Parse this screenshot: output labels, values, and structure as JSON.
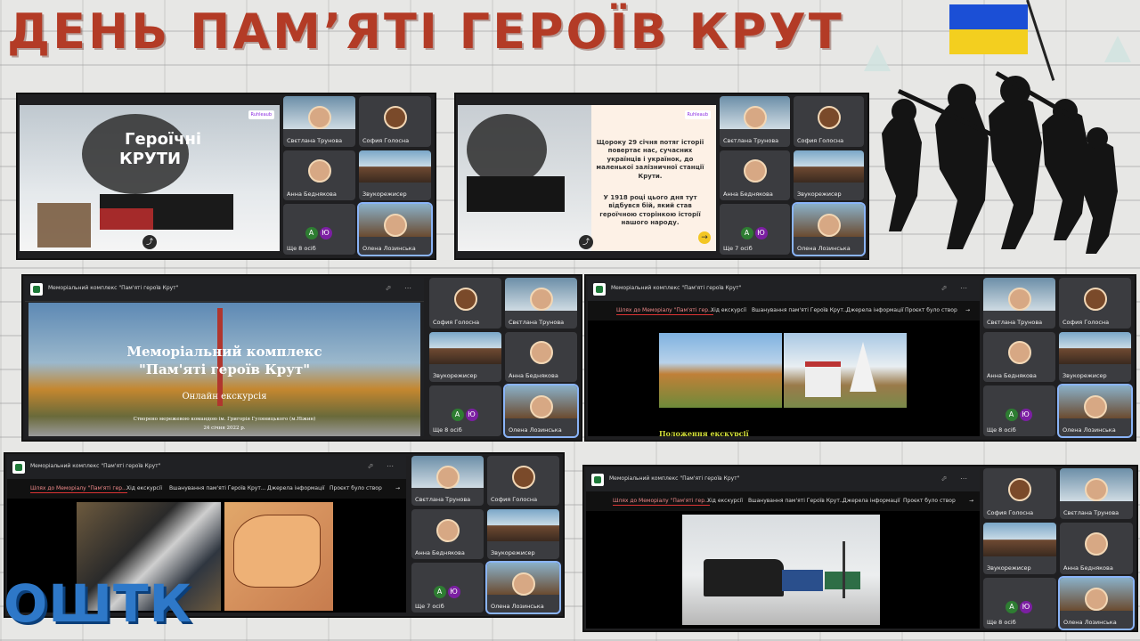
{
  "page": {
    "title": "ДЕНЬ ПАМ’ЯТІ ГЕРОЇВ КРУТ",
    "logo_text": "ОШТК",
    "flag_colors": [
      "#1b4fd6",
      "#f3cf1f"
    ]
  },
  "participants": {
    "sviatlana": "Свєтлана Трунова",
    "sofia": "София Голосна",
    "anna": "Анна Беднякова",
    "zvukorezh": "Звукорежисер",
    "olena": "Олена Лозинська",
    "more8": "Ще 8 осіб",
    "more7": "Ще 7 осіб",
    "avatar_a": "А",
    "avatar_yu": "Ю"
  },
  "shot1": {
    "slide_text_1": "Героїчні",
    "slide_text_2": "КРУТИ",
    "badge": "Ruhleaub"
  },
  "shot2": {
    "para1": "Щороку 29 січня потяг історії повертає нас, сучасних українців і українок, до маленької залізничної станції Крути.",
    "para2": "У 1918 році цього дня тут відбувся бій, який став героїчною сторінкою історії нашого народу.",
    "badge": "Ruhleaub"
  },
  "site": {
    "bar_title": "Меморіальний комплекс \"Пам'яті героїв Крут\"",
    "nav": [
      "Шлях до Меморіалу \"Пам'яті гер...",
      "Хід екскурсії",
      "Вшанування пам'яті Героїв Крут...",
      "Джерела інформації",
      "Проєкт було створ"
    ]
  },
  "shot3": {
    "heading1": "Меморіальний комплекс",
    "heading2": "\"Пам'яті героїв Крут\"",
    "sub": "Онлайн екскурсія",
    "credit": "Створено мережевою командою ім. Григорія Гуляницького (м.Ніжин)",
    "date": "24 січня 2022 р."
  },
  "shot4": {
    "caption": "Положення екскурсії"
  }
}
